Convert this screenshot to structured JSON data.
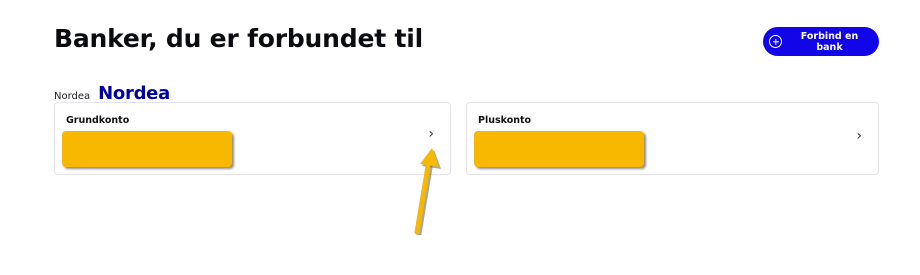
{
  "header": {
    "title": "Banker, du er forbundet til",
    "connect_button_label": "Forbind en bank",
    "connect_button_icon": "plus-circle-icon",
    "accent_color": "#1206e8"
  },
  "bank": {
    "name": "Nordea",
    "logo_text": "Nordea",
    "logo_color": "#0000a0",
    "accounts": [
      {
        "name": "Grundkonto",
        "chevron": "›"
      },
      {
        "name": "Pluskonto",
        "chevron": "›"
      }
    ]
  },
  "annotation": {
    "color": "#f9b800"
  }
}
